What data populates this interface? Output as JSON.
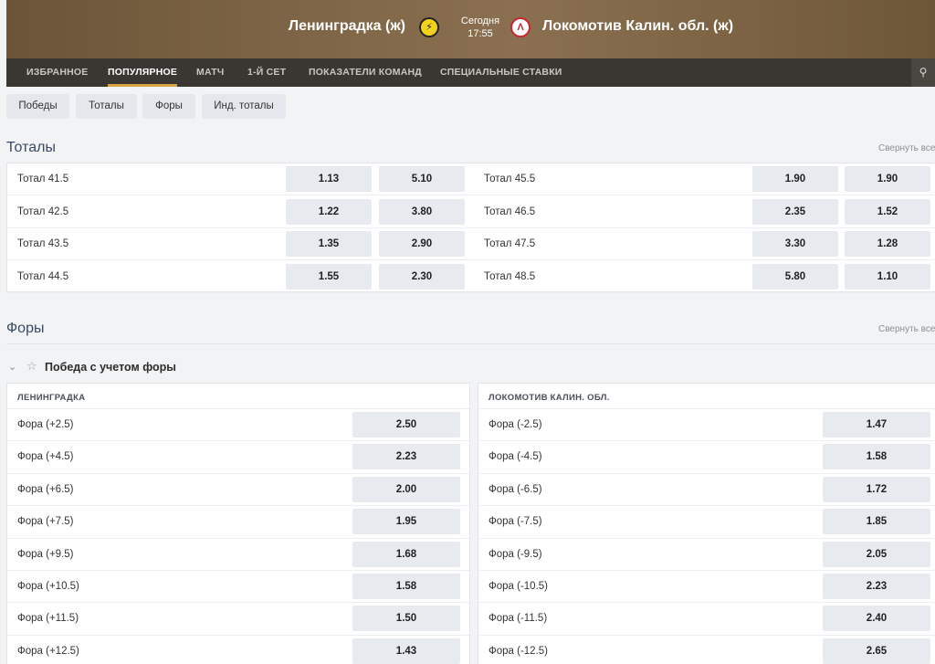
{
  "match": {
    "team_home": "Ленинградка (ж)",
    "team_away": "Локомотив Калин. обл. (ж)",
    "day": "Сегодня",
    "time": "17:55"
  },
  "nav": {
    "items": [
      "ИЗБРАННОЕ",
      "ПОПУЛЯРНОЕ",
      "МАТЧ",
      "1-Й СЕТ",
      "ПОКАЗАТЕЛИ КОМАНД",
      "СПЕЦИАЛЬНЫЕ СТАВКИ"
    ],
    "active": "ПОПУЛЯРНОЕ"
  },
  "filters": [
    "Победы",
    "Тоталы",
    "Форы",
    "Инд. тоталы"
  ],
  "totals": {
    "title": "Тоталы",
    "collapse": "Свернуть все",
    "left": [
      {
        "label": "Тотал 41.5",
        "o1": "1.13",
        "o2": "5.10"
      },
      {
        "label": "Тотал 42.5",
        "o1": "1.22",
        "o2": "3.80"
      },
      {
        "label": "Тотал 43.5",
        "o1": "1.35",
        "o2": "2.90"
      },
      {
        "label": "Тотал 44.5",
        "o1": "1.55",
        "o2": "2.30"
      }
    ],
    "right": [
      {
        "label": "Тотал 45.5",
        "o1": "1.90",
        "o2": "1.90"
      },
      {
        "label": "Тотал 46.5",
        "o1": "2.35",
        "o2": "1.52"
      },
      {
        "label": "Тотал 47.5",
        "o1": "3.30",
        "o2": "1.28"
      },
      {
        "label": "Тотал 48.5",
        "o1": "5.80",
        "o2": "1.10"
      }
    ]
  },
  "handicaps": {
    "title": "Форы",
    "collapse": "Свернуть все",
    "market": "Победа с учетом форы",
    "home_header": "ЛЕНИНГРАДКА",
    "away_header": "ЛОКОМОТИВ КАЛИН. ОБЛ.",
    "home": [
      {
        "label": "Фора (+2.5)",
        "odd": "2.50"
      },
      {
        "label": "Фора (+4.5)",
        "odd": "2.23"
      },
      {
        "label": "Фора (+6.5)",
        "odd": "2.00"
      },
      {
        "label": "Фора (+7.5)",
        "odd": "1.95"
      },
      {
        "label": "Фора (+9.5)",
        "odd": "1.68"
      },
      {
        "label": "Фора (+10.5)",
        "odd": "1.58"
      },
      {
        "label": "Фора (+11.5)",
        "odd": "1.50"
      },
      {
        "label": "Фора (+12.5)",
        "odd": "1.43"
      }
    ],
    "away": [
      {
        "label": "Фора (-2.5)",
        "odd": "1.47"
      },
      {
        "label": "Фора (-4.5)",
        "odd": "1.58"
      },
      {
        "label": "Фора (-6.5)",
        "odd": "1.72"
      },
      {
        "label": "Фора (-7.5)",
        "odd": "1.85"
      },
      {
        "label": "Фора (-9.5)",
        "odd": "2.05"
      },
      {
        "label": "Фора (-10.5)",
        "odd": "2.23"
      },
      {
        "label": "Фора (-11.5)",
        "odd": "2.40"
      },
      {
        "label": "Фора (-12.5)",
        "odd": "2.65"
      }
    ]
  }
}
